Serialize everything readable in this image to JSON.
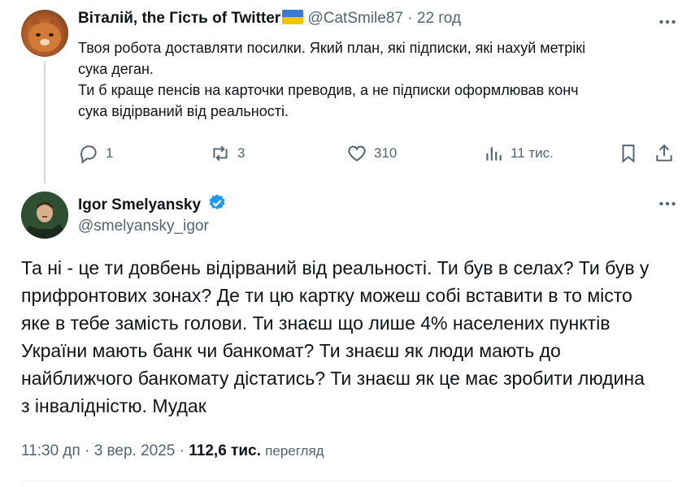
{
  "reply_tweet": {
    "display_name": "Віталій, the Гість of Twitter",
    "handle": "@CatSmile87",
    "separator": "·",
    "time": "22 год",
    "text_lines": [
      "Твоя робота доставляти посилки. Який план, які підписки, які нахуй метрікі",
      "сука деган.",
      "Ти б краще пенсів на карточки преводив, а не підписки оформлював конч",
      "сука відірваний від реальності."
    ],
    "actions": {
      "replies": "1",
      "reposts": "3",
      "likes": "310",
      "views": "11 тис."
    }
  },
  "main_tweet": {
    "display_name": "Igor Smelyansky",
    "handle": "@smelyansky_igor",
    "text_lines": [
      "Та ні - це ти довбень відірваний від реальності. Ти був в селах? Ти був у",
      "прифронтових зонах? Де ти цю картку можеш собі вставити в то місто",
      "яке в тебе замість голови. Ти знаєш що лише 4% населених пунктів",
      "України мають банк чи банкомат? Ти знаєш як люди мають до",
      "найближчого банкомату дістатись? Ти знаєш як це має зробити людина",
      "з інвалідністю. Мудак"
    ],
    "meta": {
      "time": "11:30 дп",
      "dot": "·",
      "date": "3 вер. 2025",
      "dot2": "·",
      "views_count": "112,6 тис.",
      "views_label": "перегляд"
    }
  },
  "icons": {
    "reply": "reply-icon",
    "repost": "repost-icon",
    "like": "heart-icon",
    "views": "views-icon",
    "bookmark": "bookmark-icon",
    "share": "share-icon",
    "more": "more-icon",
    "verified": "verified-icon",
    "flag": "ukraine-flag-icon"
  },
  "colors": {
    "text": "#0f1419",
    "muted": "#536471",
    "verified": "#1d9bf0",
    "thread_line": "#cfd9de"
  }
}
